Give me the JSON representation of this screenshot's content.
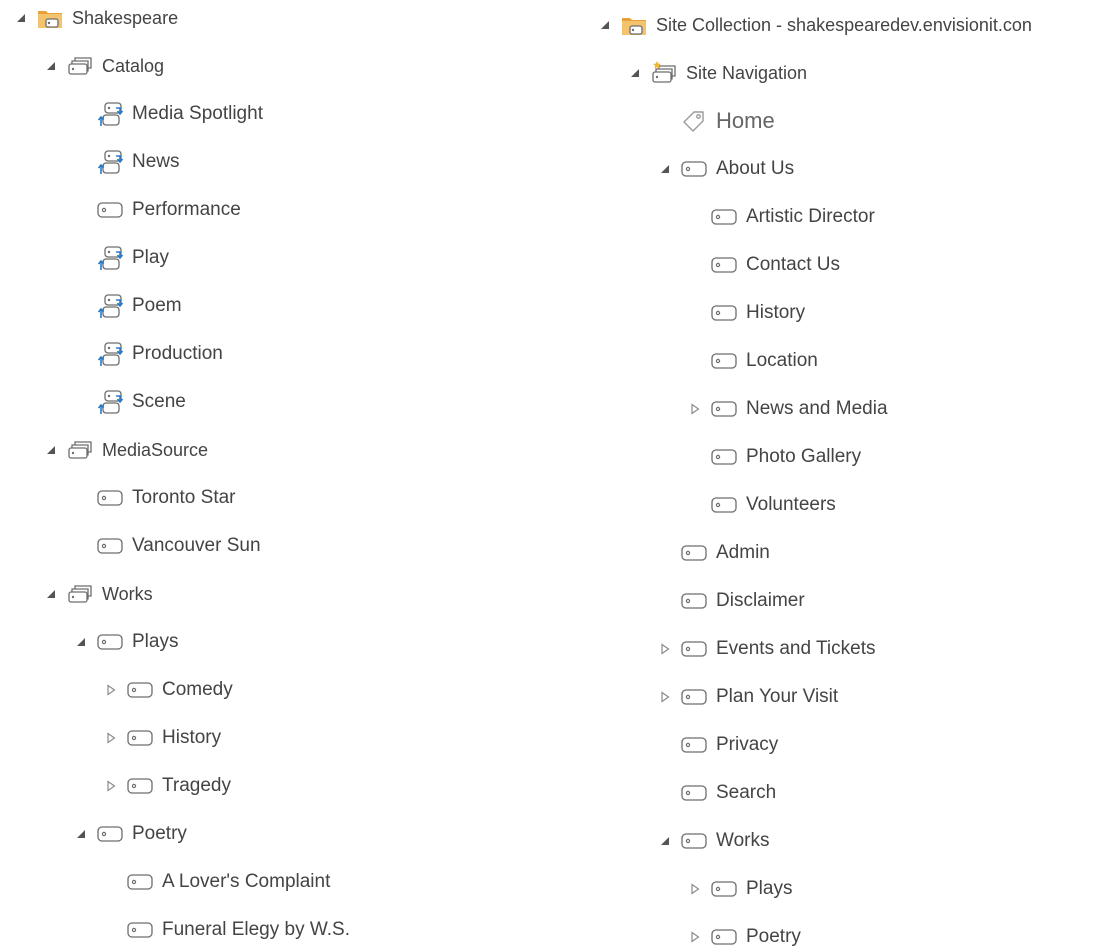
{
  "left_tree": {
    "nodes": [
      {
        "label": "Shakespeare",
        "icon": "folder-icon",
        "toggle": "expanded"
      },
      {
        "label": "Catalog",
        "icon": "term-set-icon",
        "toggle": "expanded"
      },
      {
        "label": "Media Spotlight",
        "icon": "reused-term-icon",
        "toggle": "none"
      },
      {
        "label": "News",
        "icon": "reused-term-icon",
        "toggle": "none"
      },
      {
        "label": "Performance",
        "icon": "term-icon",
        "toggle": "none"
      },
      {
        "label": "Play",
        "icon": "reused-term-icon",
        "toggle": "none"
      },
      {
        "label": "Poem",
        "icon": "reused-term-icon",
        "toggle": "none"
      },
      {
        "label": "Production",
        "icon": "reused-term-icon",
        "toggle": "none"
      },
      {
        "label": "Scene",
        "icon": "reused-term-icon",
        "toggle": "none"
      },
      {
        "label": "MediaSource",
        "icon": "term-set-icon",
        "toggle": "expanded"
      },
      {
        "label": "Toronto Star",
        "icon": "term-icon",
        "toggle": "none"
      },
      {
        "label": "Vancouver Sun",
        "icon": "term-icon",
        "toggle": "none"
      },
      {
        "label": "Works",
        "icon": "term-set-icon",
        "toggle": "expanded"
      },
      {
        "label": "Plays",
        "icon": "term-icon",
        "toggle": "expanded"
      },
      {
        "label": "Comedy",
        "icon": "term-icon",
        "toggle": "collapsed"
      },
      {
        "label": "History",
        "icon": "term-icon",
        "toggle": "collapsed"
      },
      {
        "label": "Tragedy",
        "icon": "term-icon",
        "toggle": "collapsed"
      },
      {
        "label": "Poetry",
        "icon": "term-icon",
        "toggle": "expanded"
      },
      {
        "label": "A Lover's Complaint",
        "icon": "term-icon",
        "toggle": "none"
      },
      {
        "label": "Funeral Elegy by W.S.",
        "icon": "term-icon",
        "toggle": "none"
      }
    ]
  },
  "right_tree": {
    "nodes": [
      {
        "label": "Site Collection - shakespearedev.envisionit.con",
        "icon": "folder-icon",
        "toggle": "expanded"
      },
      {
        "label": "Site Navigation",
        "icon": "navigation-term-set-icon",
        "toggle": "expanded"
      },
      {
        "label": "Home",
        "icon": "home-tag-icon",
        "toggle": "none"
      },
      {
        "label": "About Us",
        "icon": "term-icon",
        "toggle": "expanded"
      },
      {
        "label": "Artistic Director",
        "icon": "term-icon",
        "toggle": "none"
      },
      {
        "label": "Contact Us",
        "icon": "term-icon",
        "toggle": "none"
      },
      {
        "label": "History",
        "icon": "term-icon",
        "toggle": "none"
      },
      {
        "label": "Location",
        "icon": "term-icon",
        "toggle": "none"
      },
      {
        "label": "News and Media",
        "icon": "term-icon",
        "toggle": "collapsed"
      },
      {
        "label": "Photo Gallery",
        "icon": "term-icon",
        "toggle": "none"
      },
      {
        "label": "Volunteers",
        "icon": "term-icon",
        "toggle": "none"
      },
      {
        "label": "Admin",
        "icon": "term-icon",
        "toggle": "none"
      },
      {
        "label": "Disclaimer",
        "icon": "term-icon",
        "toggle": "none"
      },
      {
        "label": "Events and Tickets",
        "icon": "term-icon",
        "toggle": "collapsed"
      },
      {
        "label": "Plan Your Visit",
        "icon": "term-icon",
        "toggle": "collapsed"
      },
      {
        "label": "Privacy",
        "icon": "term-icon",
        "toggle": "none"
      },
      {
        "label": "Search",
        "icon": "term-icon",
        "toggle": "none"
      },
      {
        "label": "Works",
        "icon": "term-icon",
        "toggle": "expanded"
      },
      {
        "label": "Plays",
        "icon": "term-icon",
        "toggle": "collapsed"
      },
      {
        "label": "Poetry",
        "icon": "term-icon",
        "toggle": "collapsed"
      }
    ]
  },
  "colors": {
    "text": "#444444",
    "icon_gray": "#6d6d6d",
    "icon_blue": "#2b79c9",
    "folder_orange": "#e8a13a",
    "arrow": "#555555"
  }
}
